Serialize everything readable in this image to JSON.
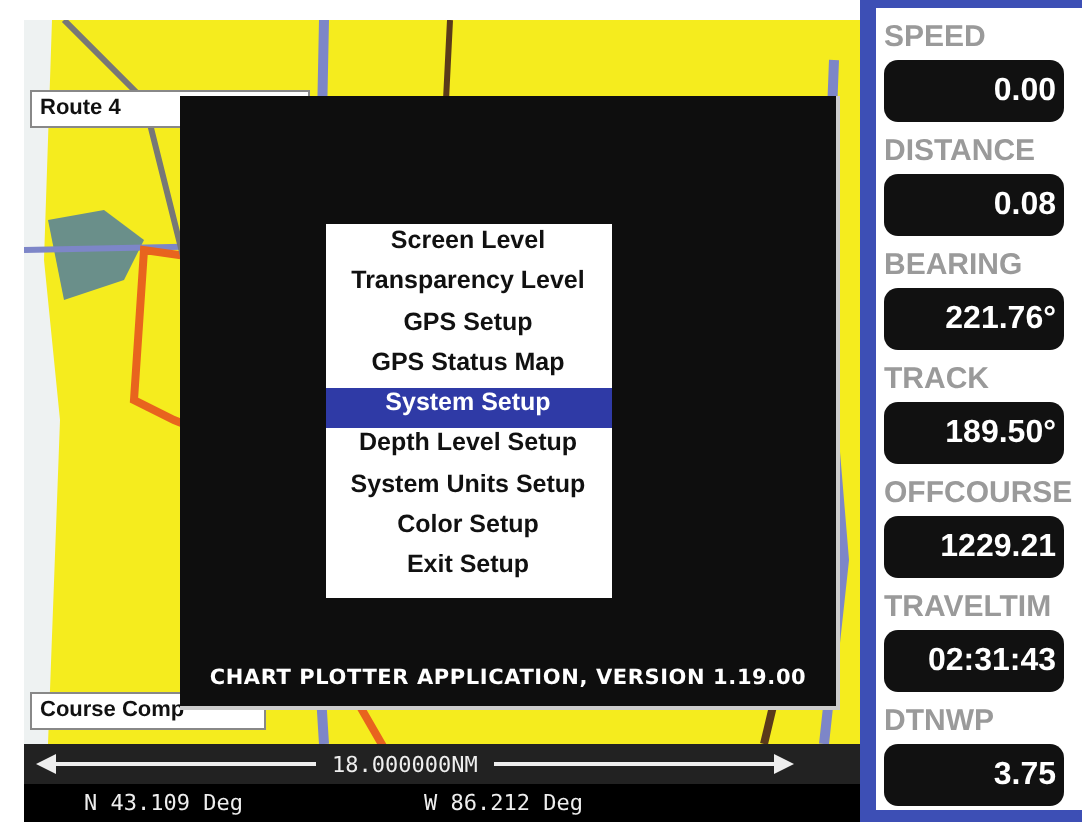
{
  "route_label": "Route 4",
  "course_label": "Course Comp",
  "dialog": {
    "menu": [
      {
        "label": "Screen Level",
        "selected": false
      },
      {
        "label": "Transparency Level",
        "selected": false
      },
      {
        "label": "GPS Setup",
        "selected": false
      },
      {
        "label": "GPS Status Map",
        "selected": false
      },
      {
        "label": "System Setup",
        "selected": true
      },
      {
        "label": "Depth Level Setup",
        "selected": false
      },
      {
        "label": "System Units Setup",
        "selected": false
      },
      {
        "label": "Color Setup",
        "selected": false
      },
      {
        "label": "Exit Setup",
        "selected": false
      }
    ],
    "version": "CHART PLOTTER APPLICATION, VERSION 1.19.00"
  },
  "scale": "18.000000NM",
  "coordinates": {
    "latitude": "N 43.109 Deg",
    "longitude": "W 86.212 Deg"
  },
  "gauges": [
    {
      "label": "SPEED",
      "value": "0.00"
    },
    {
      "label": "DISTANCE",
      "value": "0.08"
    },
    {
      "label": "BEARING",
      "value": "221.76°"
    },
    {
      "label": "TRACK",
      "value": "189.50°"
    },
    {
      "label": "OFFCOURSE",
      "value": "1229.21"
    },
    {
      "label": "TRAVELTIM",
      "value": "02:31:43"
    },
    {
      "label": "DTNWP",
      "value": "3.75"
    }
  ]
}
